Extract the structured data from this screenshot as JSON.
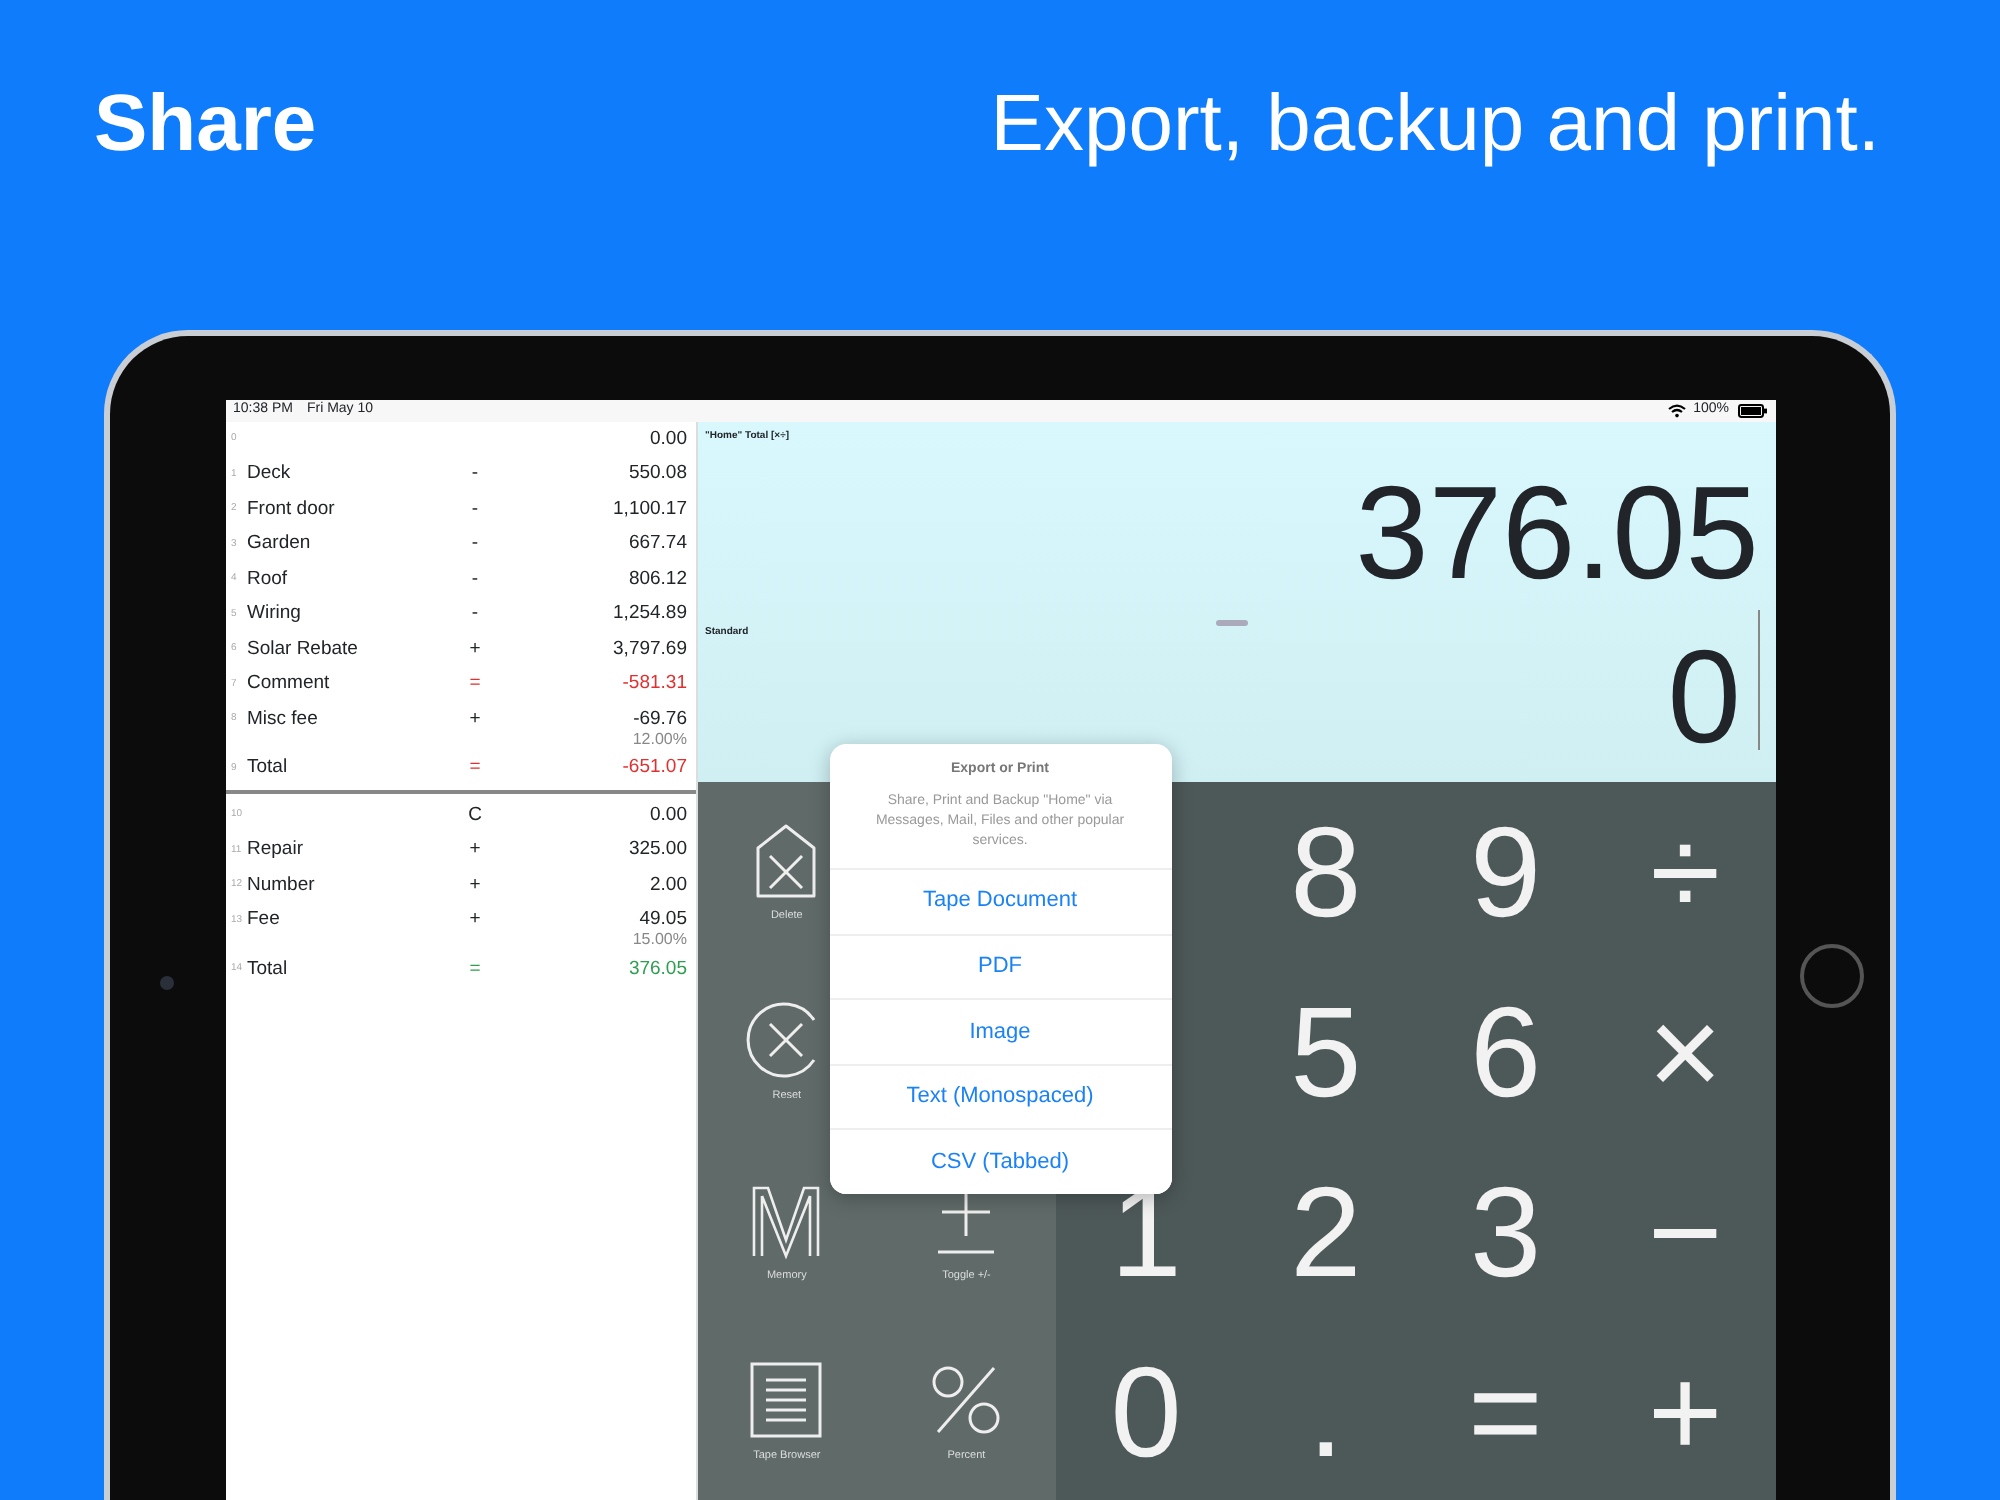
{
  "headline": {
    "title": "Share",
    "tagline": "Export, backup and print."
  },
  "status_bar": {
    "time": "10:38 PM",
    "date": "Fri May 10",
    "battery": "100%"
  },
  "tape": {
    "sections": [
      {
        "rows": [
          {
            "index": "0",
            "value": "0.00"
          },
          {
            "index": "1",
            "label": "Deck",
            "op": "-",
            "value": "550.08"
          },
          {
            "index": "2",
            "label": "Front door",
            "op": "-",
            "value": "1,100.17"
          },
          {
            "index": "3",
            "label": "Garden",
            "op": "-",
            "value": "667.74"
          },
          {
            "index": "4",
            "label": "Roof",
            "op": "-",
            "value": "806.12"
          },
          {
            "index": "5",
            "label": "Wiring",
            "op": "-",
            "value": "1,254.89"
          },
          {
            "index": "6",
            "label": "Solar Rebate",
            "op": "+",
            "value": "3,797.69"
          },
          {
            "index": "7",
            "label": "Comment",
            "op": "=",
            "value": "-581.31",
            "color": "#e0302f"
          },
          {
            "index": "8",
            "label": "Misc fee",
            "op": "+",
            "value": "-69.76",
            "note": "12.00%"
          },
          {
            "index": "9",
            "label": "Total",
            "op": "=",
            "value": "-651.07",
            "color": "#e0302f"
          }
        ]
      },
      {
        "rows": [
          {
            "index": "10",
            "op": "C",
            "value": "0.00"
          },
          {
            "index": "11",
            "label": "Repair",
            "op": "+",
            "value": "325.00"
          },
          {
            "index": "12",
            "label": "Number",
            "op": "+",
            "value": "2.00"
          },
          {
            "index": "13",
            "label": "Fee",
            "op": "+",
            "value": "49.05",
            "note": "15.00%"
          },
          {
            "index": "14",
            "label": "Total",
            "op": "=",
            "value": "376.05",
            "color": "#2e9e4f"
          }
        ]
      }
    ]
  },
  "display": {
    "caption": "\"Home\" Total [×÷]",
    "total": "376.05",
    "mode": "Standard",
    "entry": "0"
  },
  "keypad": {
    "rows": [
      {
        "functions": [
          {
            "kind": "delete",
            "label": "Delete"
          }
        ],
        "keys": [
          "8",
          "9",
          "÷"
        ]
      },
      {
        "functions": [
          {
            "kind": "reset",
            "label": "Reset"
          }
        ],
        "keys": [
          "5",
          "6",
          "×"
        ]
      },
      {
        "functions": [
          {
            "kind": "memory",
            "label": "Memory"
          },
          {
            "kind": "toggle",
            "label": "Toggle +/-"
          }
        ],
        "keys": [
          "1",
          "2",
          "3",
          "−"
        ]
      },
      {
        "functions": [
          {
            "kind": "tape",
            "label": "Tape Browser"
          },
          {
            "kind": "percent",
            "label": "Percent"
          }
        ],
        "keys": [
          "0",
          ".",
          "=",
          "+"
        ]
      }
    ]
  },
  "popover": {
    "title": "Export or Print",
    "message": "Share, Print and Backup \"Home\" via Messages, Mail, Files and other popular services.",
    "options": [
      "Tape Document",
      "PDF",
      "Image",
      "Text (Monospaced)",
      "CSV (Tabbed)"
    ]
  }
}
